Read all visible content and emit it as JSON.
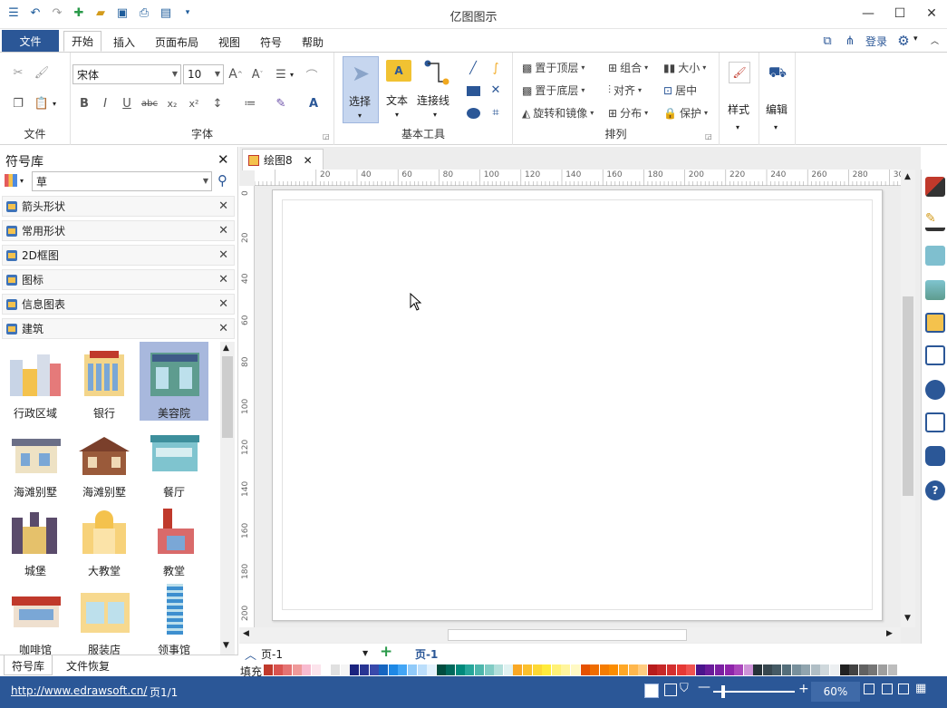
{
  "app": {
    "title": "亿图图示"
  },
  "menu": {
    "file": "文件",
    "tabs": [
      "开始",
      "插入",
      "页面布局",
      "视图",
      "符号",
      "帮助"
    ],
    "login": "登录"
  },
  "ribbon": {
    "file_group": "文件",
    "font_group": "字体",
    "font_name": "宋体",
    "font_size": "10",
    "basic_tools_group": "基本工具",
    "select": "选择",
    "text": "文本",
    "connector": "连接线",
    "arrange_group": "排列",
    "bring_front": "置于顶层",
    "send_back": "置于底层",
    "rotate_mirror": "旋转和镜像",
    "group": "组合",
    "align": "对齐",
    "distribute": "分布",
    "size": "大小",
    "center": "居中",
    "protect": "保护",
    "style": "样式",
    "edit": "编辑"
  },
  "library": {
    "title": "符号库",
    "search_value": "草",
    "categories": [
      "箭头形状",
      "常用形状",
      "2D框图",
      "图标",
      "信息图表",
      "建筑"
    ],
    "shapes": [
      "行政区域",
      "银行",
      "美容院",
      "海滩别墅",
      "海滩别墅",
      "餐厅",
      "城堡",
      "大教堂",
      "教堂",
      "咖啡馆",
      "服装店",
      "领事馆"
    ],
    "bottom_tabs": [
      "符号库",
      "文件恢复"
    ]
  },
  "document": {
    "tab": "绘图8",
    "ruler_h": [
      "20",
      "40",
      "60",
      "80",
      "100",
      "120",
      "140",
      "160",
      "180",
      "200",
      "220",
      "240",
      "260",
      "280",
      "30"
    ],
    "ruler_v": [
      "0",
      "20",
      "40",
      "60",
      "80",
      "100",
      "120",
      "140",
      "160",
      "180",
      "200"
    ]
  },
  "pagebar": {
    "page_select": "页-1",
    "page_tab": "页-1",
    "fill_label": "填充"
  },
  "status": {
    "url": "http://www.edrawsoft.cn/",
    "page": "页1/1",
    "zoom": "60%"
  },
  "colors": {
    "accent": "#2b5797",
    "selected": "#a8b8dd"
  }
}
